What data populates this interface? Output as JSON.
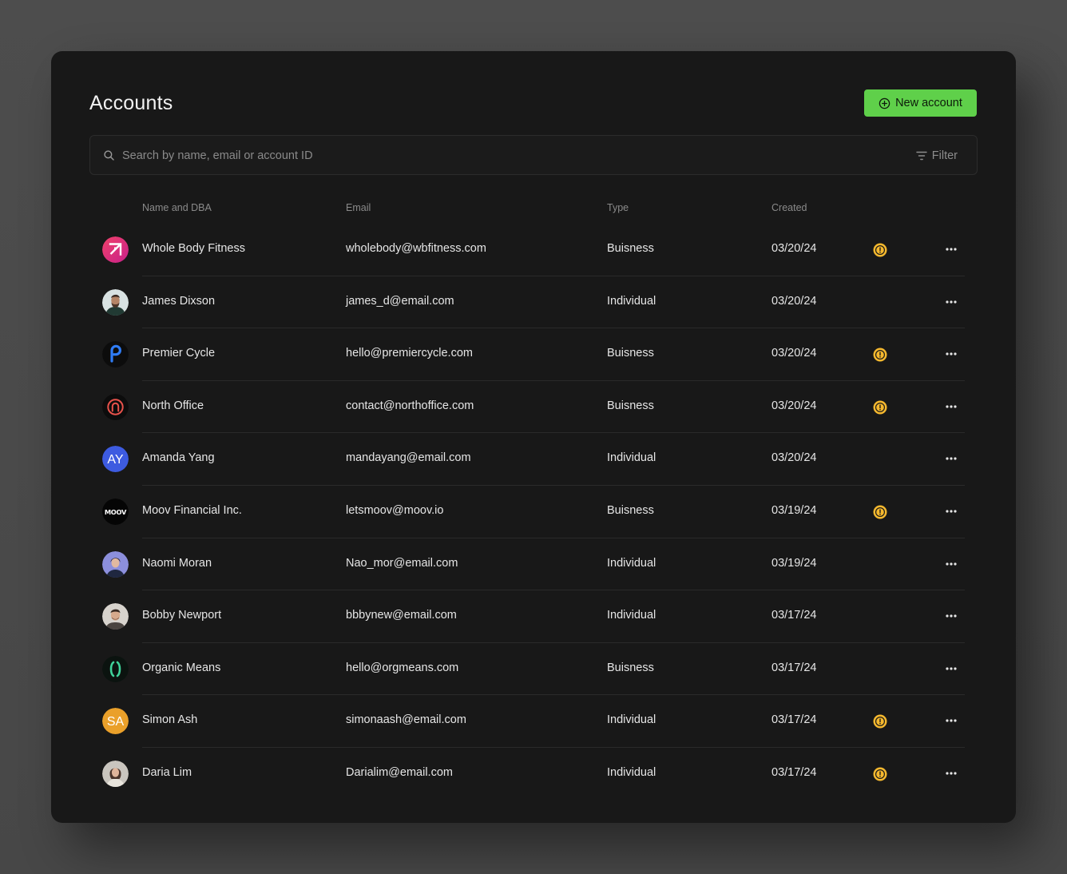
{
  "page": {
    "title": "Accounts"
  },
  "toolbar": {
    "new_account_label": "New account"
  },
  "search": {
    "placeholder": "Search by name, email or account ID",
    "filter_label": "Filter"
  },
  "table": {
    "columns": {
      "name": "Name and DBA",
      "email": "Email",
      "type": "Type",
      "created": "Created"
    },
    "rows": [
      {
        "name": "Whole Body Fitness",
        "email": "wholebody@wbfitness.com",
        "type": "Buisness",
        "created": "03/20/24",
        "warning": true,
        "avatar": "whole-body-fitness-logo"
      },
      {
        "name": "James Dixson",
        "email": "james_d@email.com",
        "type": "Individual",
        "created": "03/20/24",
        "warning": false,
        "avatar": "james-dixson-photo"
      },
      {
        "name": "Premier Cycle",
        "email": "hello@premiercycle.com",
        "type": "Buisness",
        "created": "03/20/24",
        "warning": true,
        "avatar": "premier-cycle-logo"
      },
      {
        "name": "North Office",
        "email": "contact@northoffice.com",
        "type": "Buisness",
        "created": "03/20/24",
        "warning": true,
        "avatar": "north-office-logo"
      },
      {
        "name": "Amanda Yang",
        "email": "mandayang@email.com",
        "type": "Individual",
        "created": "03/20/24",
        "warning": false,
        "avatar": "initials",
        "initials": "AY"
      },
      {
        "name": "Moov Financial Inc.",
        "email": "letsmoov@moov.io",
        "type": "Buisness",
        "created": "03/19/24",
        "warning": true,
        "avatar": "moov-logo",
        "logo_text": "MOOV"
      },
      {
        "name": "Naomi Moran",
        "email": "Nao_mor@email.com",
        "type": "Individual",
        "created": "03/19/24",
        "warning": false,
        "avatar": "naomi-moran-photo"
      },
      {
        "name": "Bobby Newport",
        "email": "bbbynew@email.com",
        "type": "Individual",
        "created": "03/17/24",
        "warning": false,
        "avatar": "bobby-newport-photo"
      },
      {
        "name": "Organic Means",
        "email": "hello@orgmeans.com",
        "type": "Buisness",
        "created": "03/17/24",
        "warning": false,
        "avatar": "organic-means-logo"
      },
      {
        "name": "Simon Ash",
        "email": "simonaash@email.com",
        "type": "Individual",
        "created": "03/17/24",
        "warning": true,
        "avatar": "initials",
        "initials": "SA"
      },
      {
        "name": "Daria Lim",
        "email": "Darialim@email.com",
        "type": "Individual",
        "created": "03/17/24",
        "warning": true,
        "avatar": "daria-lim-photo"
      }
    ]
  },
  "colors": {
    "accent": "#5fd04a",
    "card_background": "#181818",
    "warning": "#f5b82e",
    "amanda_avatar": "#3d5be0",
    "simon_avatar": "#eaa02a"
  },
  "icons": {
    "new_account": "plus-circle-icon",
    "search": "search-icon",
    "filter": "filter-icon",
    "warning": "warning-icon",
    "more": "more-horizontal-icon"
  }
}
